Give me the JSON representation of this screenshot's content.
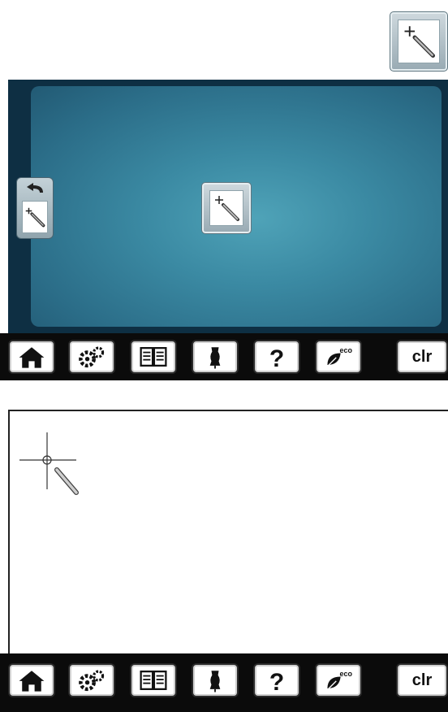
{
  "icons": {
    "calibrate": "calibration-pen-icon",
    "back": "back-arrow-icon",
    "home": "home-icon",
    "setup": "gears-icon",
    "tutorial": "book-icon",
    "creative_consultant": "dress-form-icon",
    "help": "question-icon",
    "eco": "eco-leaf-icon",
    "crosshair": "crosshair-target-icon"
  },
  "toolbar": {
    "help_label": "?",
    "eco_label": "eco",
    "clr_label": "clr"
  },
  "colors": {
    "screen_bg": "#0e2f43",
    "canvas_bg": "#3b8aa3",
    "toolbar_bg": "#0b0b0b"
  }
}
